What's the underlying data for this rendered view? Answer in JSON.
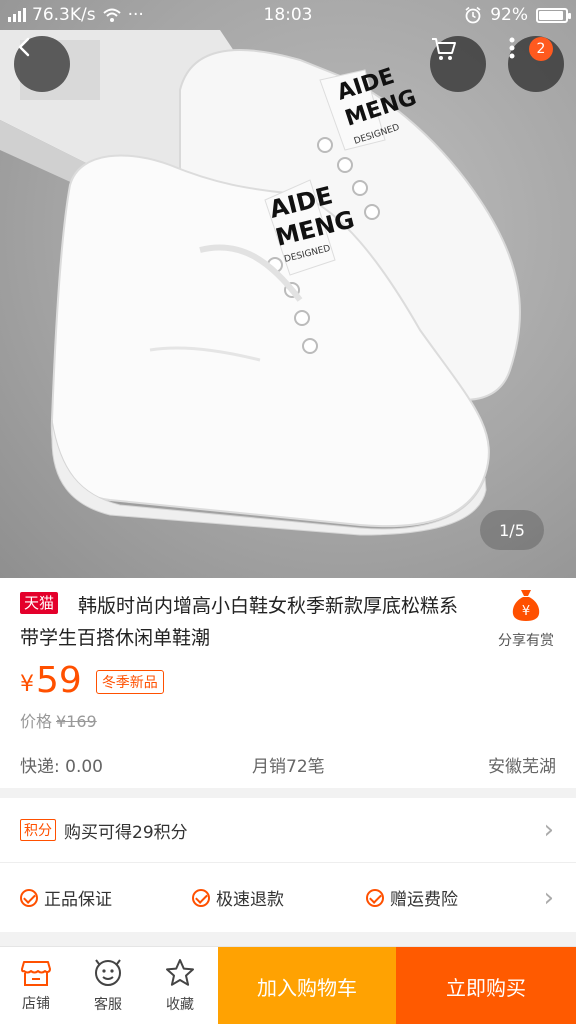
{
  "status_bar": {
    "speed": "76.3K/s",
    "dots": "···",
    "time": "18:03",
    "battery_percent": "92%",
    "battery_level": 0.92
  },
  "hero": {
    "notification_count": "2",
    "page_indicator": "1/5",
    "shoe_print_line1": "AIDE",
    "shoe_print_line2": "MENG",
    "shoe_print_line3": "DESIGNED"
  },
  "product": {
    "mall_badge": "天猫",
    "title": "韩版时尚内增高小白鞋女秋季新款厚底松糕系带学生百搭休闲单鞋潮",
    "share_label": "分享有赏",
    "currency": "¥",
    "price": "59",
    "season_tag": "冬季新品",
    "orig_price_label": "价格",
    "orig_price": "¥169",
    "shipping": "快递: 0.00",
    "monthly_sales": "月销72笔",
    "location": "安徽芜湖"
  },
  "points": {
    "tag": "积分",
    "text": "购买可得29积分"
  },
  "guarantees": [
    "正品保证",
    "极速退款",
    "赠运费险"
  ],
  "bottom_bar": {
    "store_label": "店铺",
    "service_label": "客服",
    "favorite_label": "收藏",
    "add_to_cart": "加入购物车",
    "buy_now": "立即购买"
  },
  "colors": {
    "accent": "#ff5000",
    "cart_button": "#ffa202",
    "buy_button": "#ff5a00",
    "tmall_red": "#e4002b"
  }
}
